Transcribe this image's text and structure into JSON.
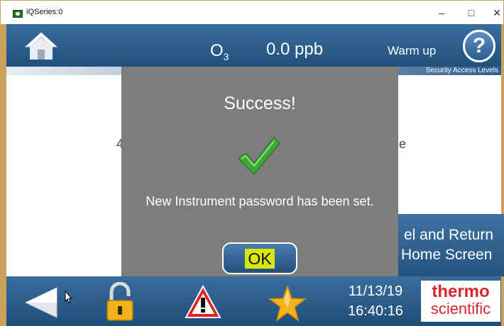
{
  "window": {
    "title": "iQSeries:0",
    "min_glyph": "–",
    "max_glyph": "□",
    "close_glyph": "✕"
  },
  "header": {
    "home_icon": "home-icon",
    "gas_symbol": "O",
    "gas_subscript": "3",
    "reading": "0.0 ppb",
    "status": "Warm up",
    "help_label": "?",
    "section_label": "Security Access Levels"
  },
  "content": {
    "left_fragment": "4",
    "right_fragment": "e",
    "cancel_line1": "el and Return",
    "cancel_line2": "Home Screen"
  },
  "dialog": {
    "title": "Success!",
    "message": "New Instrument password has been set.",
    "ok_label": "OK",
    "check_icon": "checkmark-icon"
  },
  "footer": {
    "date": "11/13/19",
    "time": "16:40:16",
    "logo_line1": "thermo",
    "logo_line2": "scientific",
    "icons": [
      "back-arrow-icon",
      "lock-icon",
      "warning-icon",
      "star-icon"
    ]
  },
  "colors": {
    "header_blue": "#2c5e8e",
    "dialog_gray": "#7d7d7d",
    "ok_highlight": "#d7e60b",
    "brand_red": "#d7262c",
    "frame_gold": "#c9a35a"
  }
}
